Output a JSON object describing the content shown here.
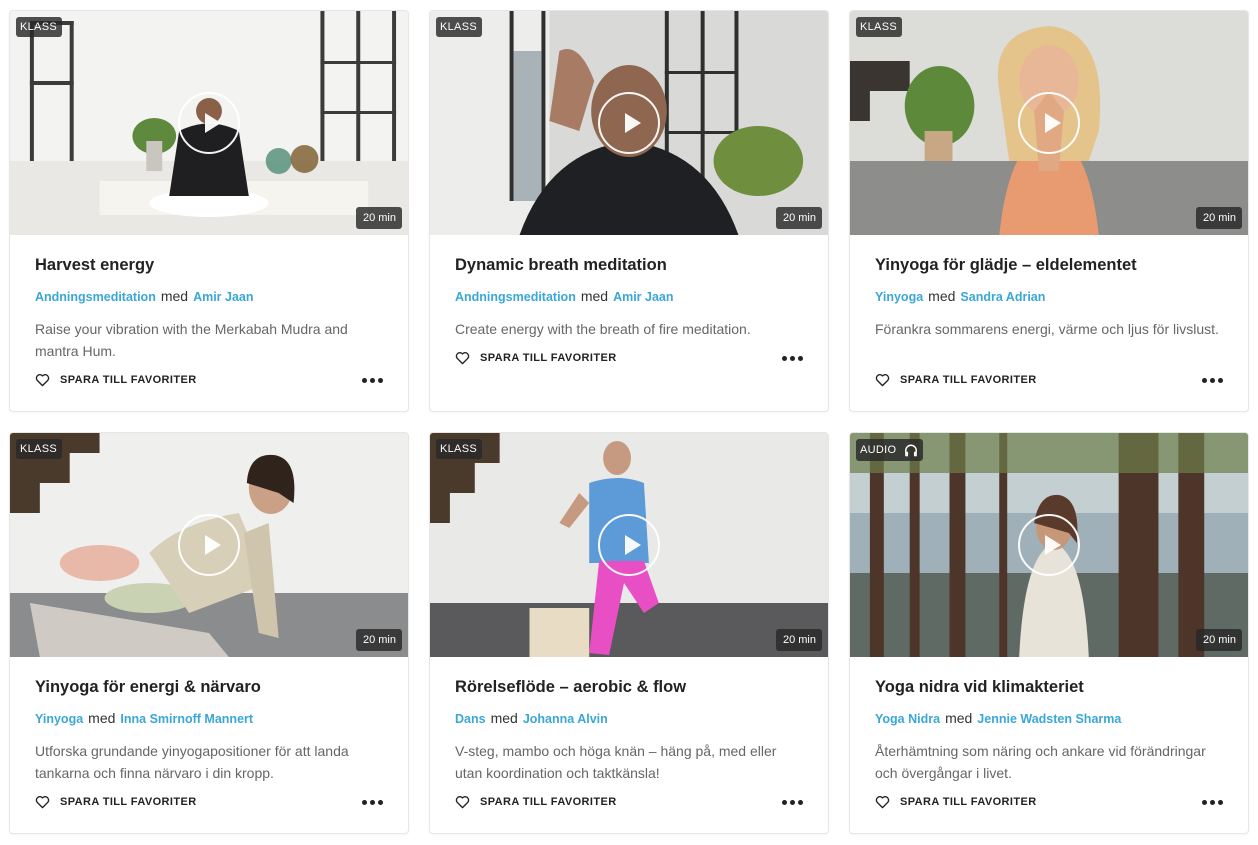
{
  "cards": [
    {
      "badge": "KLASS",
      "duration": "20 min",
      "title": "Harvest energy",
      "category": "Andningsmeditation",
      "with": "med",
      "teacher": "Amir Jaan",
      "description": "Raise your vibration with the Merkabah Mudra and mantra Hum.",
      "favorite_label": "SPARA TILL FAVORITER"
    },
    {
      "badge": "KLASS",
      "duration": "20 min",
      "title": "Dynamic breath meditation",
      "category": "Andningsmeditation",
      "with": "med",
      "teacher": "Amir Jaan",
      "description": "Create energy with the breath of fire meditation.",
      "favorite_label": "SPARA TILL FAVORITER"
    },
    {
      "badge": "KLASS",
      "duration": "20 min",
      "title": "Yinyoga för glädje – eldelementet",
      "category": "Yinyoga",
      "with": "med",
      "teacher": "Sandra Adrian",
      "description": "Förankra sommarens energi, värme och ljus för livslust.",
      "favorite_label": "SPARA TILL FAVORITER"
    },
    {
      "badge": "KLASS",
      "duration": "20 min",
      "title": "Yinyoga för energi & närvaro",
      "category": "Yinyoga",
      "with": "med",
      "teacher": "Inna Smirnoff Mannert",
      "description": "Utforska grundande yinyogapositioner för att landa tankarna och finna närvaro i din kropp.",
      "favorite_label": "SPARA TILL FAVORITER"
    },
    {
      "badge": "KLASS",
      "duration": "20 min",
      "title": "Rörelseflöde – aerobic & flow",
      "category": "Dans",
      "with": "med",
      "teacher": "Johanna Alvin",
      "description": "V-steg, mambo och höga knän – häng på, med eller utan koordination och taktkänsla!",
      "favorite_label": "SPARA TILL FAVORITER"
    },
    {
      "badge": "AUDIO",
      "badge_icon": "headphones-icon",
      "duration": "20 min",
      "title": "Yoga nidra vid klimakteriet",
      "category": "Yoga Nidra",
      "with": "med",
      "teacher": "Jennie Wadsten Sharma",
      "description": "Återhämtning som näring och ankare vid förändringar och övergångar i livet.",
      "favorite_label": "SPARA TILL FAVORITER"
    }
  ],
  "colors": {
    "link": "#3aa7d6",
    "title": "#222222",
    "description": "#666666",
    "badge_bg": "#282828"
  }
}
